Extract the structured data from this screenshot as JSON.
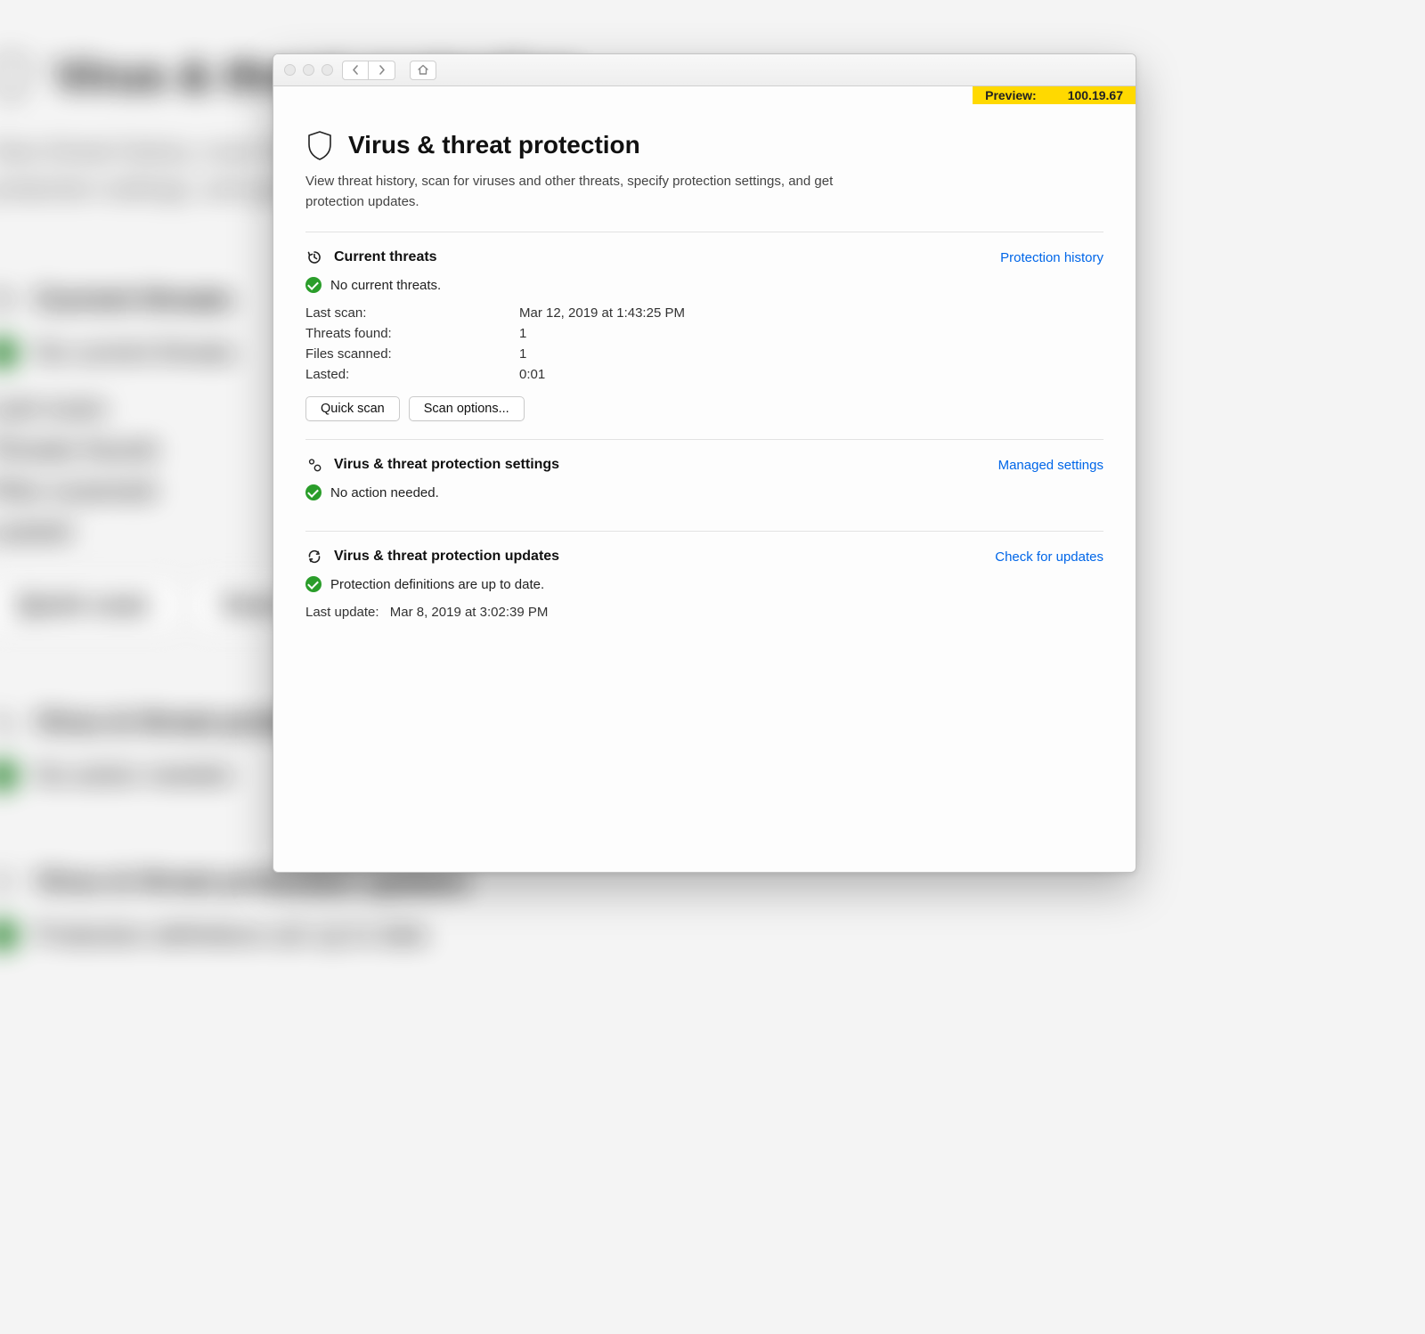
{
  "preview": {
    "label": "Preview:",
    "version": "100.19.67"
  },
  "page": {
    "title": "Virus & threat protection",
    "description": "View threat history, scan for viruses and other threats, specify protection settings, and get protection updates."
  },
  "threats": {
    "heading": "Current threats",
    "history_link": "Protection history",
    "status": "No current threats.",
    "last_scan_label": "Last scan:",
    "last_scan_value": "Mar 12, 2019 at 1:43:25 PM",
    "threats_found_label": "Threats found:",
    "threats_found_value": "1",
    "files_scanned_label": "Files scanned:",
    "files_scanned_value": "1",
    "lasted_label": "Lasted:",
    "lasted_value": "0:01",
    "quick_scan_label": "Quick scan",
    "scan_options_label": "Scan options..."
  },
  "settings": {
    "heading": "Virus & threat protection settings",
    "link": "Managed settings",
    "status": "No action needed."
  },
  "updates": {
    "heading": "Virus & threat protection updates",
    "link": "Check for updates",
    "status": "Protection definitions are up to date.",
    "last_update_label": "Last update:",
    "last_update_value": "Mar 8, 2019 at 3:02:39 PM"
  }
}
